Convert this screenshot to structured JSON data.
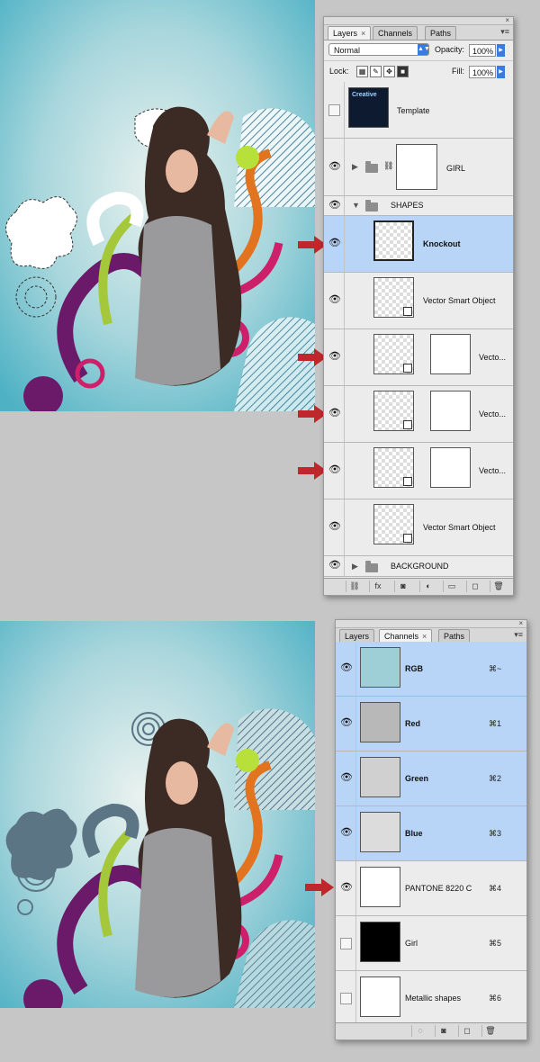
{
  "layers_panel": {
    "tabs": [
      "Layers",
      "Channels",
      "Paths"
    ],
    "tab_close": "×",
    "panel_close": "×",
    "blend_mode": "Normal",
    "opacity_label": "Opacity:",
    "opacity_value": "100%",
    "lock_label": "Lock:",
    "fill_label": "Fill:",
    "fill_value": "100%",
    "layers": [
      {
        "name": "Template"
      },
      {
        "name": "GIRL"
      },
      {
        "name": "SHAPES"
      },
      {
        "name": "Knockout"
      },
      {
        "name": "Vector Smart Object"
      },
      {
        "name": "Vecto..."
      },
      {
        "name": "Vecto..."
      },
      {
        "name": "Vecto..."
      },
      {
        "name": "Vector Smart Object"
      },
      {
        "name": "BACKGROUND"
      }
    ],
    "template_thumb_text": "Creative"
  },
  "channels_panel": {
    "tabs": [
      "Layers",
      "Channels",
      "Paths"
    ],
    "tab_close": "×",
    "panel_close": "×",
    "channels": [
      {
        "name": "RGB",
        "shortcut": "⌘~"
      },
      {
        "name": "Red",
        "shortcut": "⌘1"
      },
      {
        "name": "Green",
        "shortcut": "⌘2"
      },
      {
        "name": "Blue",
        "shortcut": "⌘3"
      },
      {
        "name": "PANTONE 8220 C",
        "shortcut": "⌘4"
      },
      {
        "name": "Girl",
        "shortcut": "⌘5"
      },
      {
        "name": "Metallic shapes",
        "shortcut": "⌘6"
      }
    ]
  },
  "colors": {
    "selection": "#b8d4f6",
    "arrow_red": "#c0272d",
    "canvas_teal": "#8ccad5"
  },
  "icons": {
    "eye": "eye-icon",
    "chain": "link-icon",
    "arrow": "red-arrow-icon"
  }
}
